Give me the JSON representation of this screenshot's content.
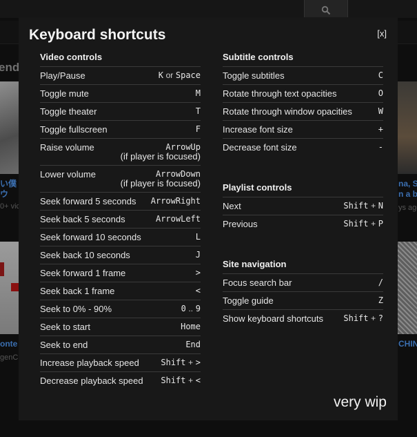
{
  "modal": {
    "title": "Keyboard shortcuts",
    "close_label": "[x]",
    "footer": "very wip"
  },
  "background": {
    "heading_left": "ende",
    "left_title_1": "い僕",
    "left_title_2": "ウ",
    "left_meta_1": "0+ vic",
    "left_title_3": "onte",
    "left_meta_2": "genCl",
    "right_title_1": "na, Sl",
    "right_title_2": "n a bi",
    "right_meta_1": "ys ago",
    "right_title_3": "CHIN"
  },
  "video": {
    "title": "Video controls",
    "rows": [
      {
        "label": "Play/Pause",
        "k1": "K",
        "sep": "or",
        "k2": "Space"
      },
      {
        "label": "Toggle mute",
        "k1": "M"
      },
      {
        "label": "Toggle theater",
        "k1": "T"
      },
      {
        "label": "Toggle fullscreen",
        "k1": "F"
      },
      {
        "label": "Raise volume",
        "k1": "ArrowUp",
        "note": "(if player is focused)"
      },
      {
        "label": "Lower volume",
        "k1": "ArrowDown",
        "note": "(if player is focused)"
      },
      {
        "label": "Seek forward 5 seconds",
        "k1": "ArrowRight"
      },
      {
        "label": "Seek back 5 seconds",
        "k1": "ArrowLeft"
      },
      {
        "label": "Seek forward 10 seconds",
        "k1": "L"
      },
      {
        "label": "Seek back 10 seconds",
        "k1": "J"
      },
      {
        "label": "Seek forward 1 frame",
        "k1": ">"
      },
      {
        "label": "Seek back 1 frame",
        "k1": "<"
      },
      {
        "label": "Seek to 0% - 90%",
        "k1": "0",
        "sep": "..",
        "k2": "9"
      },
      {
        "label": "Seek to start",
        "k1": "Home"
      },
      {
        "label": "Seek to end",
        "k1": "End"
      },
      {
        "label": "Increase playback speed",
        "k1": "Shift",
        "sep": "+",
        "k2": ">"
      },
      {
        "label": "Decrease playback speed",
        "k1": "Shift",
        "sep": "+",
        "k2": "<"
      }
    ]
  },
  "subtitle": {
    "title": "Subtitle controls",
    "rows": [
      {
        "label": "Toggle subtitles",
        "k1": "C"
      },
      {
        "label": "Rotate through text opacities",
        "k1": "O"
      },
      {
        "label": "Rotate through window opacities",
        "k1": "W"
      },
      {
        "label": "Increase font size",
        "k1": "+"
      },
      {
        "label": "Decrease font size",
        "k1": "-"
      }
    ]
  },
  "playlist": {
    "title": "Playlist controls",
    "rows": [
      {
        "label": "Next",
        "k1": "Shift",
        "sep": "+",
        "k2": "N"
      },
      {
        "label": "Previous",
        "k1": "Shift",
        "sep": "+",
        "k2": "P"
      }
    ]
  },
  "site": {
    "title": "Site navigation",
    "rows": [
      {
        "label": "Focus search bar",
        "k1": "/"
      },
      {
        "label": "Toggle guide",
        "k1": "Z"
      },
      {
        "label": "Show keyboard shortcuts",
        "k1": "Shift",
        "sep": "+",
        "k2": "?"
      }
    ]
  }
}
